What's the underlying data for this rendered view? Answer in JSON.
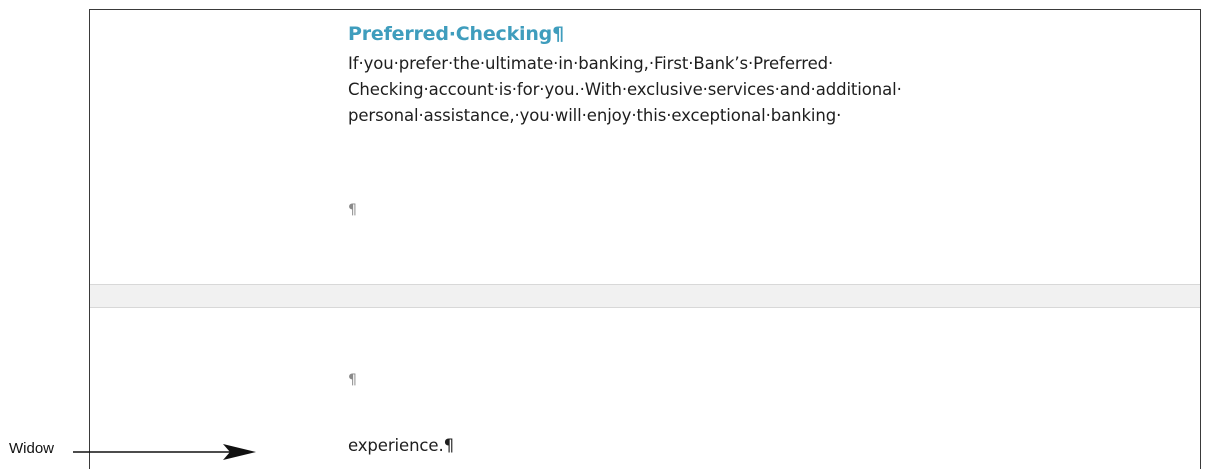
{
  "document": {
    "heading": "Preferred·Checking¶",
    "paragraph_lines": [
      "If·you·prefer·the·ultimate·in·banking,·First·Bank’s·Preferred·",
      "Checking·account·is·for·you.·With·exclusive·services·and·additional·",
      "personal·assistance,·you·will·enjoy·this·exceptional·banking·"
    ],
    "empty_paragraph_mark_page1": "¶",
    "empty_paragraph_mark_page2": "¶",
    "widow_line": "experience.¶"
  },
  "annotation": {
    "label": "Widow"
  }
}
